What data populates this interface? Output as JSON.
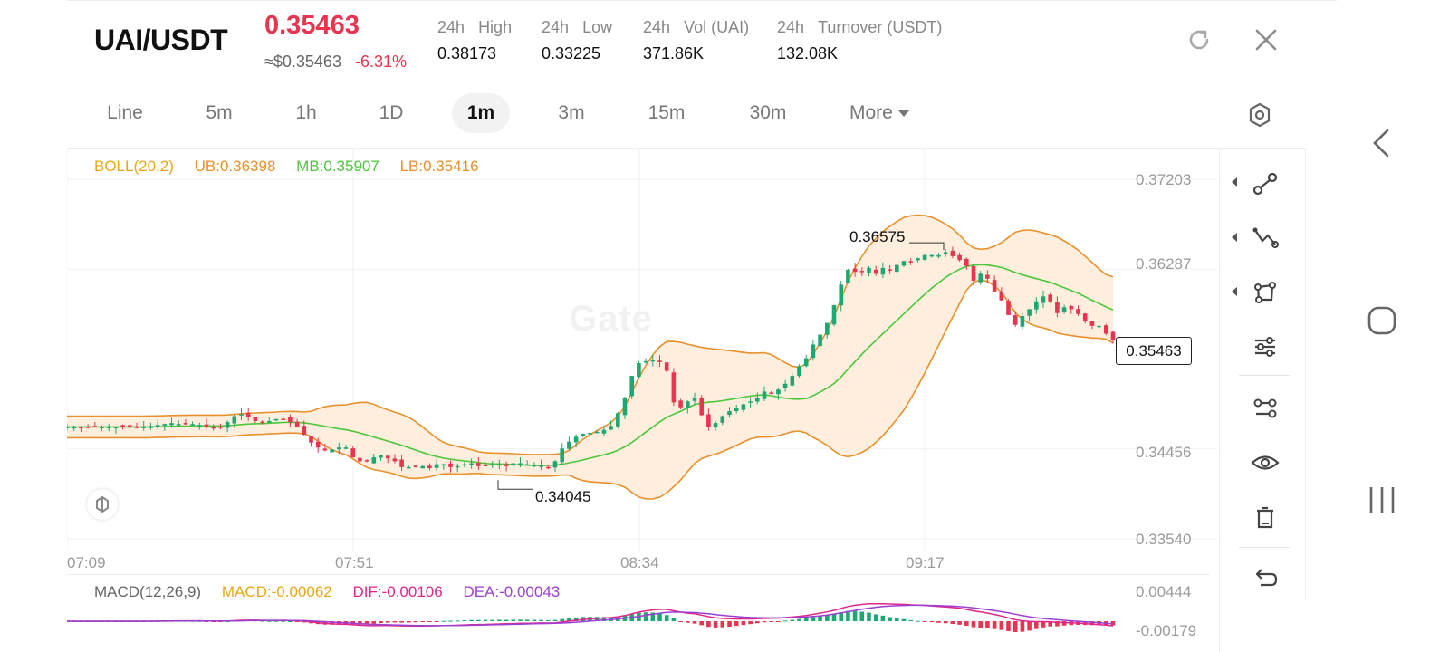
{
  "header": {
    "pair": "UAI/USDT",
    "price": "0.35463",
    "usd_approx": "≈$0.35463",
    "change_pct": "-6.31%",
    "stats": [
      {
        "label_prefix": "24h",
        "label": "High",
        "value": "0.38173"
      },
      {
        "label_prefix": "24h",
        "label": "Low",
        "value": "0.33225"
      },
      {
        "label_prefix": "24h",
        "label": "Vol (UAI)",
        "value": "371.86K"
      },
      {
        "label_prefix": "24h",
        "label": "Turnover (USDT)",
        "value": "132.08K"
      }
    ],
    "icons": [
      "refresh-icon",
      "close-icon"
    ]
  },
  "timeframes": {
    "items": [
      "Line",
      "5m",
      "1h",
      "1D",
      "1m",
      "3m",
      "15m",
      "30m"
    ],
    "active": "1m",
    "more_label": "More"
  },
  "main_chart": {
    "boll_legend": {
      "name": "BOLL(20,2)",
      "ub": "UB:0.36398",
      "mb": "MB:0.35907",
      "lb": "LB:0.35416"
    },
    "y_ticks": [
      "0.37203",
      "0.36287",
      "0.35463",
      "0.34456",
      "0.33540"
    ],
    "x_ticks": [
      "07:09",
      "07:51",
      "08:34",
      "09:17"
    ],
    "current_price_tag": "0.35463",
    "high_marker": "0.36575",
    "low_marker": "0.34045",
    "watermark": "Gate"
  },
  "macd": {
    "name": "MACD(12,26,9)",
    "macd": "MACD:-0.00062",
    "dif": "DIF:-0.00106",
    "dea": "DEA:-0.00043",
    "y_ticks": [
      "0.00444",
      "-0.00179"
    ]
  },
  "toolbar": {
    "tools": [
      "trend-line-icon",
      "polyline-icon",
      "shape-icon",
      "indicator-settings-icon",
      "compare-icon",
      "visibility-icon",
      "delete-icon",
      "undo-icon"
    ]
  },
  "colors": {
    "up": "#1fa773",
    "down": "#e8344f",
    "boll_ub": "#e8902a",
    "boll_mb": "#4cc63a",
    "band_fill": "#fdeedd",
    "macd_dif": "#e0268a",
    "macd_dea": "#9b3fd1",
    "legend_name": "#e6a817"
  },
  "chart_data": {
    "type": "candlestick",
    "title": "",
    "xlabel": "",
    "ylabel": "",
    "x_ticks": [
      "07:09",
      "07:51",
      "08:34",
      "09:17"
    ],
    "ylim": [
      0.3354,
      0.37203
    ],
    "grid": true,
    "close_approx": [
      0.3468,
      0.3468,
      0.3468,
      0.3468,
      0.3468,
      0.3468,
      0.3468,
      0.3468,
      0.3468,
      0.3468,
      0.3468,
      0.3468,
      0.3469,
      0.347,
      0.3471,
      0.3472,
      0.3471,
      0.3471,
      0.3471,
      0.347,
      0.3468,
      0.3467,
      0.3468,
      0.3473,
      0.3479,
      0.3481,
      0.3478,
      0.3474,
      0.3473,
      0.3474,
      0.3476,
      0.3476,
      0.3473,
      0.3468,
      0.346,
      0.3452,
      0.3447,
      0.3444,
      0.3445,
      0.3447,
      0.3447,
      0.3437,
      0.3433,
      0.3433,
      0.3437,
      0.3439,
      0.3436,
      0.3433,
      0.3427,
      0.3427,
      0.3427,
      0.3428,
      0.3426,
      0.343,
      0.343,
      0.3427,
      0.3428,
      0.343,
      0.3431,
      0.3428,
      0.3428,
      0.343,
      0.343,
      0.3428,
      0.3431,
      0.3431,
      0.343,
      0.3429,
      0.3429,
      0.3426,
      0.3433,
      0.3446,
      0.3453,
      0.3458,
      0.3461,
      0.3462,
      0.3463,
      0.3465,
      0.3469,
      0.3482,
      0.3498,
      0.352,
      0.3533,
      0.3535,
      0.3536,
      0.3534,
      0.3525,
      0.3493,
      0.3488,
      0.3494,
      0.3498,
      0.348,
      0.3468,
      0.3472,
      0.3479,
      0.3484,
      0.3487,
      0.3491,
      0.3494,
      0.3498,
      0.3504,
      0.3502,
      0.3506,
      0.3512,
      0.352,
      0.353,
      0.3538,
      0.3552,
      0.3562,
      0.3574,
      0.3592,
      0.3613,
      0.3628,
      0.3626,
      0.3627,
      0.363,
      0.3624,
      0.363,
      0.3628,
      0.3633,
      0.3637,
      0.3636,
      0.364,
      0.3643,
      0.3643,
      0.3643,
      0.3646,
      0.3642,
      0.3638,
      0.3632,
      0.3617,
      0.3624,
      0.3619,
      0.3606,
      0.3597,
      0.3582,
      0.3572,
      0.3581,
      0.3588,
      0.3596,
      0.3601,
      0.3596,
      0.3584,
      0.359,
      0.3588,
      0.3583,
      0.3576,
      0.3571,
      0.3571,
      0.3563,
      0.3557
    ]
  }
}
